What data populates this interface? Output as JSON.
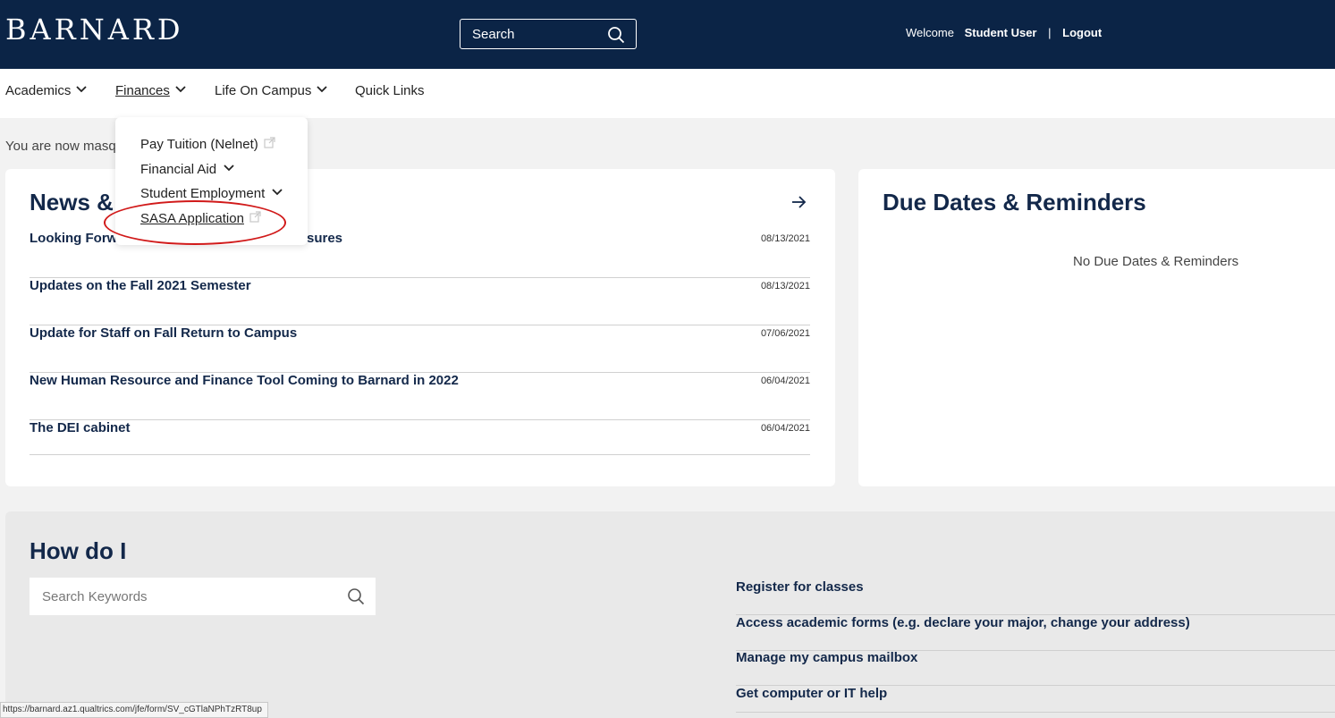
{
  "header": {
    "logo": "BARNARD",
    "search_placeholder": "Search",
    "welcome": "Welcome",
    "user_name": "Student User",
    "separator": "|",
    "logout": "Logout",
    "background_color": "#0b2446"
  },
  "nav": {
    "items": [
      {
        "label": "Academics",
        "has_dropdown": true
      },
      {
        "label": "Finances",
        "has_dropdown": true,
        "active": true
      },
      {
        "label": "Life On Campus",
        "has_dropdown": true
      },
      {
        "label": "Quick Links",
        "has_dropdown": false
      }
    ]
  },
  "finances_menu": {
    "items": [
      {
        "label": "Pay Tuition (Nelnet)",
        "icon": "external-link-icon"
      },
      {
        "label": "Financial Aid",
        "icon": "chevron-down-icon"
      },
      {
        "label": "Student Employment",
        "icon": "chevron-down-icon"
      },
      {
        "label": "SASA Application",
        "icon": "external-link-icon",
        "highlighted": true
      }
    ],
    "highlight_color": "#d11a1a"
  },
  "masquerade_text": "You are now masqu",
  "news": {
    "title": "News &",
    "items": [
      {
        "title": "Looking Forwa",
        "title_tail": "sures",
        "date": "08/13/2021"
      },
      {
        "title": "Updates on the Fall 2021 Semester",
        "date": "08/13/2021"
      },
      {
        "title": "Update for Staff on Fall Return to Campus",
        "date": "07/06/2021"
      },
      {
        "title": "New Human Resource and Finance Tool Coming to Barnard in 2022",
        "date": "06/04/2021"
      },
      {
        "title": "The DEI cabinet",
        "date": "06/04/2021"
      }
    ]
  },
  "due_dates": {
    "title": "Due Dates & Reminders",
    "empty_text": "No Due Dates & Reminders"
  },
  "how_do_i": {
    "title": "How do I",
    "search_placeholder": "Search Keywords",
    "links": [
      "Register for classes",
      "Access academic forms (e.g. declare your major, change your address)",
      "Manage my campus mailbox",
      "Get computer or IT help"
    ]
  },
  "status_bar": {
    "url": "https://barnard.az1.qualtrics.com/jfe/form/SV_cGTlaNPhTzRT8up"
  }
}
